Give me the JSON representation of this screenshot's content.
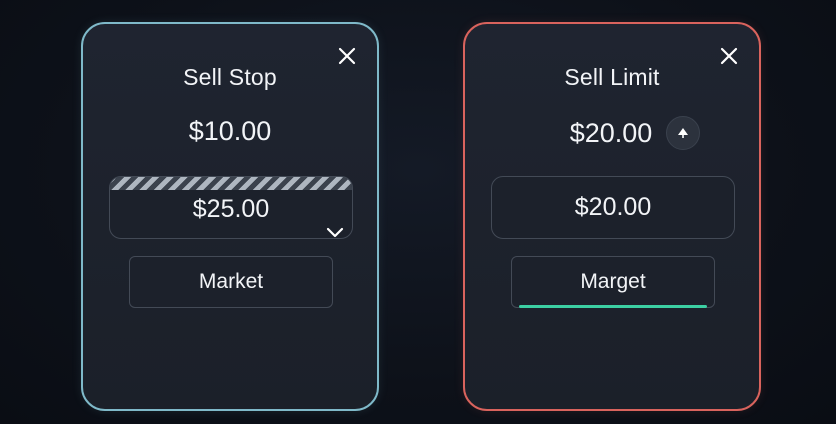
{
  "cards": [
    {
      "title": "Sell Stop",
      "price": "$10.00",
      "input_value": "$25.00",
      "button_label": "Market",
      "border_color": "#7fb9c9"
    },
    {
      "title": "Sell Limit",
      "price": "$20.00",
      "input_value": "$20.00",
      "button_label": "Marget",
      "border_color": "#d9635d",
      "accent_color": "#3ccfa3"
    }
  ],
  "icons": {
    "close": "close-icon",
    "dropdown": "chevron-down-icon",
    "increment": "arrow-up-icon"
  }
}
